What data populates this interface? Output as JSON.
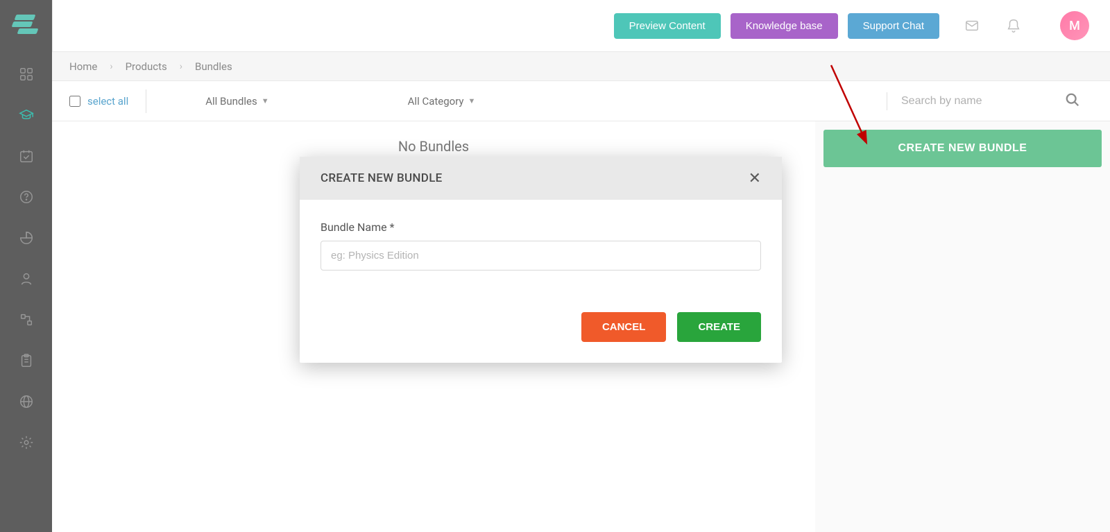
{
  "topbar": {
    "preview": "Preview Content",
    "knowledge": "Knowledge base",
    "support": "Support Chat",
    "avatar_initial": "M"
  },
  "breadcrumb": {
    "home": "Home",
    "products": "Products",
    "bundles": "Bundles"
  },
  "filters": {
    "select_all": "select all",
    "all_bundles": "All Bundles",
    "all_category": "All Category",
    "search_placeholder": "Search by name"
  },
  "main": {
    "empty_text": "No Bundles",
    "create_bundle_btn": "CREATE NEW BUNDLE"
  },
  "modal": {
    "title": "CREATE NEW BUNDLE",
    "label": "Bundle Name *",
    "placeholder": "eg: Physics Edition",
    "cancel": "CANCEL",
    "create": "CREATE"
  }
}
